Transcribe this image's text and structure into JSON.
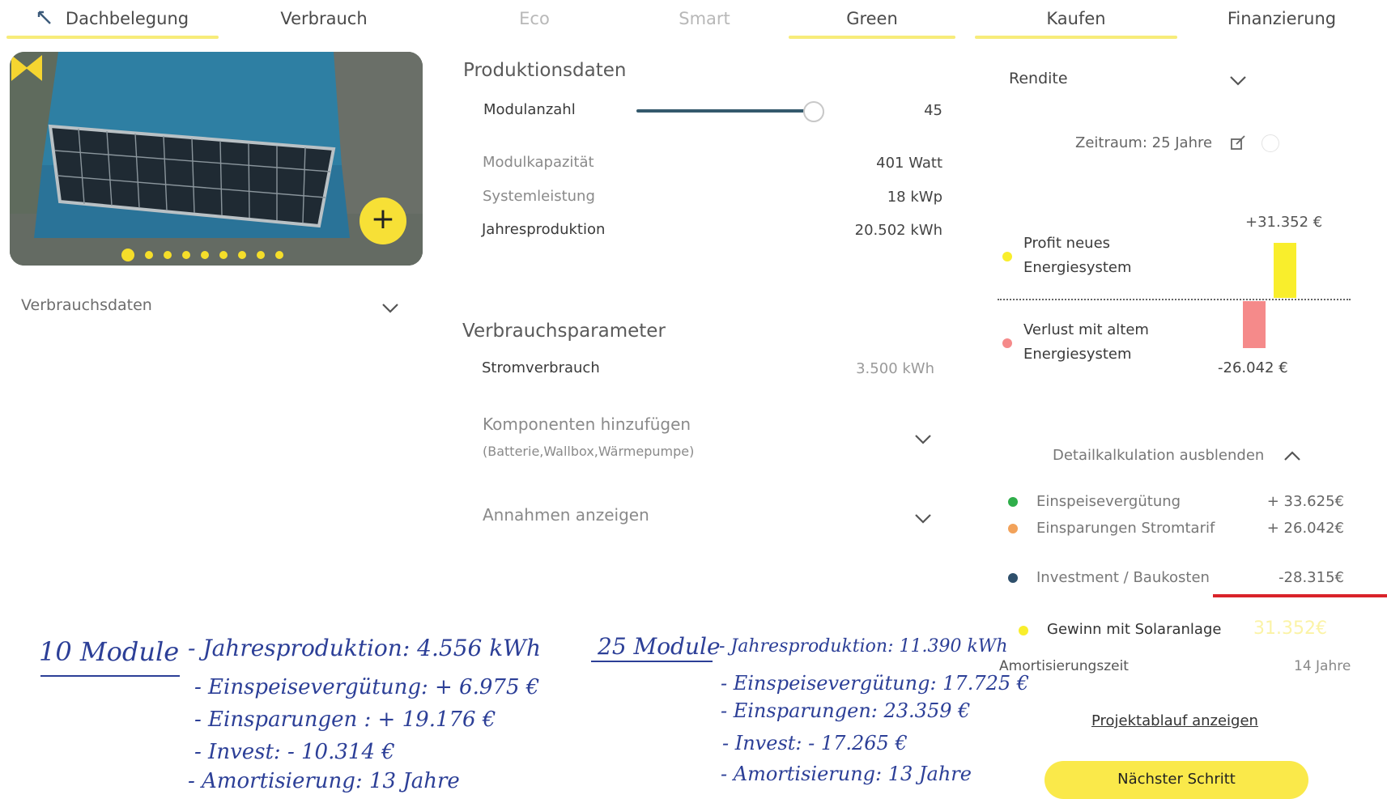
{
  "tabs": [
    {
      "label": "Dachbelegung",
      "state": "active"
    },
    {
      "label": "Verbrauch",
      "state": "normal"
    },
    {
      "label": "Eco",
      "state": "muted"
    },
    {
      "label": "Smart",
      "state": "muted"
    },
    {
      "label": "Green",
      "state": "selected"
    },
    {
      "label": "Kaufen",
      "state": "selected"
    },
    {
      "label": "Finanzierung",
      "state": "normal"
    }
  ],
  "carousel": {
    "add_label": "+",
    "dot_count": 9,
    "active_dot": 1
  },
  "verbrauchsdaten": {
    "label": "Verbrauchsdaten"
  },
  "produktion": {
    "title": "Produktionsdaten",
    "modulanzahl_label": "Modulanzahl",
    "modulanzahl_value": "45",
    "slider_fraction": 0.94,
    "modulkapazitaet_label": "Modulkapazität",
    "modulkapazitaet_value": "401 Watt",
    "systemleistung_label": "Systemleistung",
    "systemleistung_value": "18 kWp",
    "jahresproduktion_label": "Jahresproduktion",
    "jahresproduktion_value": "20.502 kWh"
  },
  "verbrauchsparameter": {
    "title": "Verbrauchsparameter",
    "stromverbrauch_label": "Stromverbrauch",
    "stromverbrauch_value": "3.500 kWh",
    "komponenten_label": "Komponenten hinzufügen",
    "komponenten_sub": "(Batterie,Wallbox,Wärmepumpe)",
    "annahmen_label": "Annahmen anzeigen"
  },
  "rendite": {
    "label": "Rendite",
    "zeitraum": "Zeitraum: 25 Jahre",
    "profit_value": "+31.352 €",
    "profit_label_1": "Profit neues",
    "profit_label_2": "Energiesystem",
    "loss_value": "-26.042 €",
    "loss_label_1": "Verlust mit altem",
    "loss_label_2": "Energiesystem",
    "colors": {
      "profit": "#f9ee2c",
      "loss": "#f58a8a"
    }
  },
  "detail": {
    "toggle_label": "Detailkalkulation ausblenden",
    "items": [
      {
        "label": "Einspeisevergütung",
        "value": "+ 33.625€",
        "color": "#2fae4a"
      },
      {
        "label": "Einsparungen Stromtarif",
        "value": "+ 26.042€",
        "color": "#f2a25a"
      },
      {
        "label": "Investment / Baukosten",
        "value": "-28.315€",
        "color": "#2e4f6b"
      }
    ],
    "gewinn_label": "Gewinn mit Solaranlage",
    "gewinn_value": "31.352€",
    "amortisierung_label": "Amortisierungszeit",
    "amortisierung_value": "14 Jahre",
    "projekt_link": "Projektablauf anzeigen",
    "next_button": "Nächster Schritt"
  },
  "handwritten": {
    "left_title": "10 Module",
    "left_lines": [
      "- Jahresproduktion: 4.556 kWh",
      "- Einspeisevergütung: + 6.975 €",
      "- Einsparungen : + 19.176 €",
      "- Invest: - 10.314 €",
      "- Amortisierung: 13 Jahre"
    ],
    "right_title": "25 Module",
    "right_lines": [
      "- Jahresproduktion: 11.390 kWh",
      "- Einspeisevergütung: 17.725 €",
      "- Einsparungen: 23.359 €",
      "- Invest: - 17.265 €",
      "- Amortisierung: 13 Jahre"
    ]
  }
}
